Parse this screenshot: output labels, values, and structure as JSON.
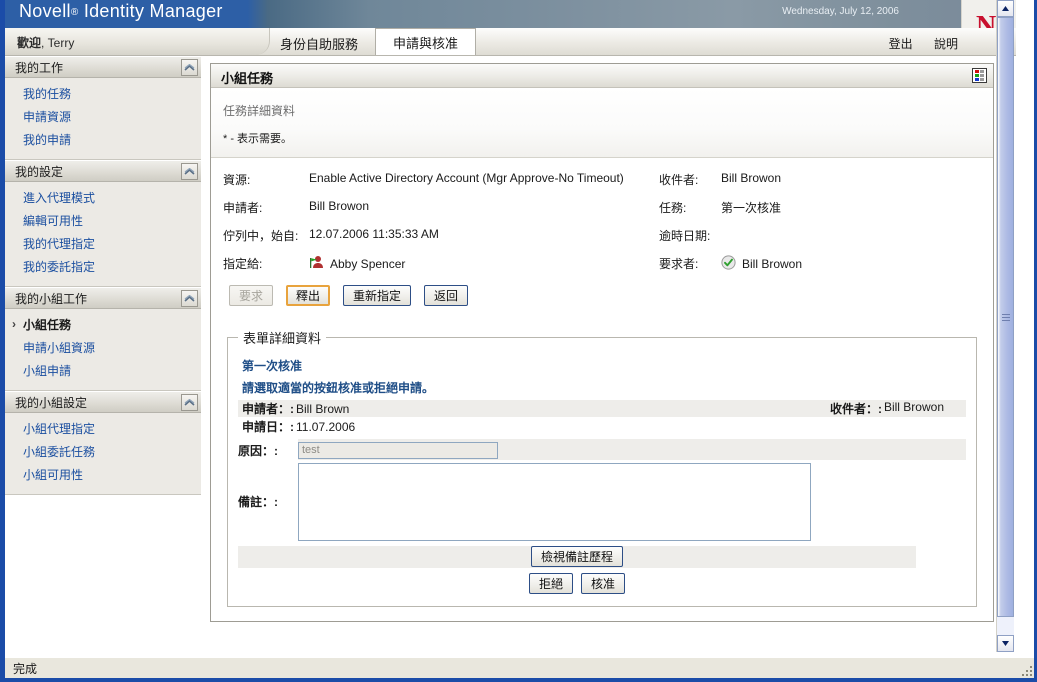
{
  "banner": {
    "product": "Novell",
    "registered": "®",
    "product_suffix": "Identity Manager",
    "date": "Wednesday, July 12, 2006",
    "logo_letter": "N",
    "logo_color": "#c8102e"
  },
  "subheader": {
    "welcome_label": "歡迎",
    "welcome_user": ", Terry",
    "tabs": [
      {
        "label": "身份自助服務",
        "active": false
      },
      {
        "label": "申請與核准",
        "active": true
      }
    ],
    "links": [
      {
        "label": "登出"
      },
      {
        "label": "說明"
      }
    ]
  },
  "sidebar": {
    "groups": [
      {
        "title": "我的工作",
        "collapse_icon": "chevron-up-icon",
        "items": [
          {
            "label": "我的任務",
            "current": false
          },
          {
            "label": "申請資源",
            "current": false
          },
          {
            "label": "我的申請",
            "current": false
          }
        ]
      },
      {
        "title": "我的設定",
        "collapse_icon": "chevron-up-icon",
        "items": [
          {
            "label": "進入代理模式",
            "current": false
          },
          {
            "label": "編輯可用性",
            "current": false
          },
          {
            "label": "我的代理指定",
            "current": false
          },
          {
            "label": "我的委託指定",
            "current": false
          }
        ]
      },
      {
        "title": "我的小組工作",
        "collapse_icon": "chevron-up-icon",
        "items": [
          {
            "label": "小組任務",
            "current": true
          },
          {
            "label": "申請小組資源",
            "current": false
          },
          {
            "label": "小組申請",
            "current": false
          }
        ]
      },
      {
        "title": "我的小組設定",
        "collapse_icon": "chevron-up-icon",
        "items": [
          {
            "label": "小組代理指定",
            "current": false
          },
          {
            "label": "小組委託任務",
            "current": false
          },
          {
            "label": "小組可用性",
            "current": false
          }
        ]
      }
    ]
  },
  "panel": {
    "title": "小組任務",
    "icon": "color-legend-icon",
    "subtitle": "任務詳細資料",
    "required_note": "* - 表示需要。",
    "detail": {
      "left": [
        {
          "label": "資源:",
          "value": "Enable Active Directory Account (Mgr Approve-No Timeout)",
          "icon": null
        },
        {
          "label": "申請者:",
          "value": "Bill Browon",
          "icon": null
        },
        {
          "label": "佇列中，始自:",
          "value": "12.07.2006 11:35:33 AM",
          "icon": null
        },
        {
          "label": "指定給:",
          "value": "Abby Spencer",
          "icon": "user-flag-icon"
        }
      ],
      "right": [
        {
          "label": "收件者:",
          "value": "Bill Browon",
          "icon": null
        },
        {
          "label": "任務:",
          "value": "第一次核准",
          "icon": null
        },
        {
          "label": "逾時日期:",
          "value": "",
          "icon": null
        },
        {
          "label": "要求者:",
          "value": "Bill Browon",
          "icon": "green-check-icon"
        }
      ]
    },
    "action_buttons": [
      {
        "label": "要求",
        "state": "disabled"
      },
      {
        "label": "釋出",
        "state": "focused"
      },
      {
        "label": "重新指定",
        "state": "normal"
      },
      {
        "label": "返回",
        "state": "normal"
      }
    ]
  },
  "form_details": {
    "legend": "表單詳細資料",
    "title": "第一次核准",
    "instruction": "請選取適當的按鈕核准或拒絕申請。",
    "rows": [
      {
        "key": "申請者：:",
        "value": "Bill Brown",
        "shaded": true,
        "right_key": "收件者：:",
        "right_value": "Bill Browon"
      },
      {
        "key": "申請日：:",
        "value": "11.07.2006",
        "shaded": false,
        "right_key": "",
        "right_value": ""
      }
    ],
    "reason_label": "原因：:",
    "reason_value": "test",
    "comment_label": "備註：:",
    "comment_value": "",
    "history_button": "檢視備註歷程",
    "deny_button": "拒絕",
    "approve_button": "核准"
  },
  "statusbar": {
    "text": "完成"
  },
  "scrollbar": {
    "up_icon": "scroll-up-icon",
    "down_icon": "scroll-down-icon"
  }
}
